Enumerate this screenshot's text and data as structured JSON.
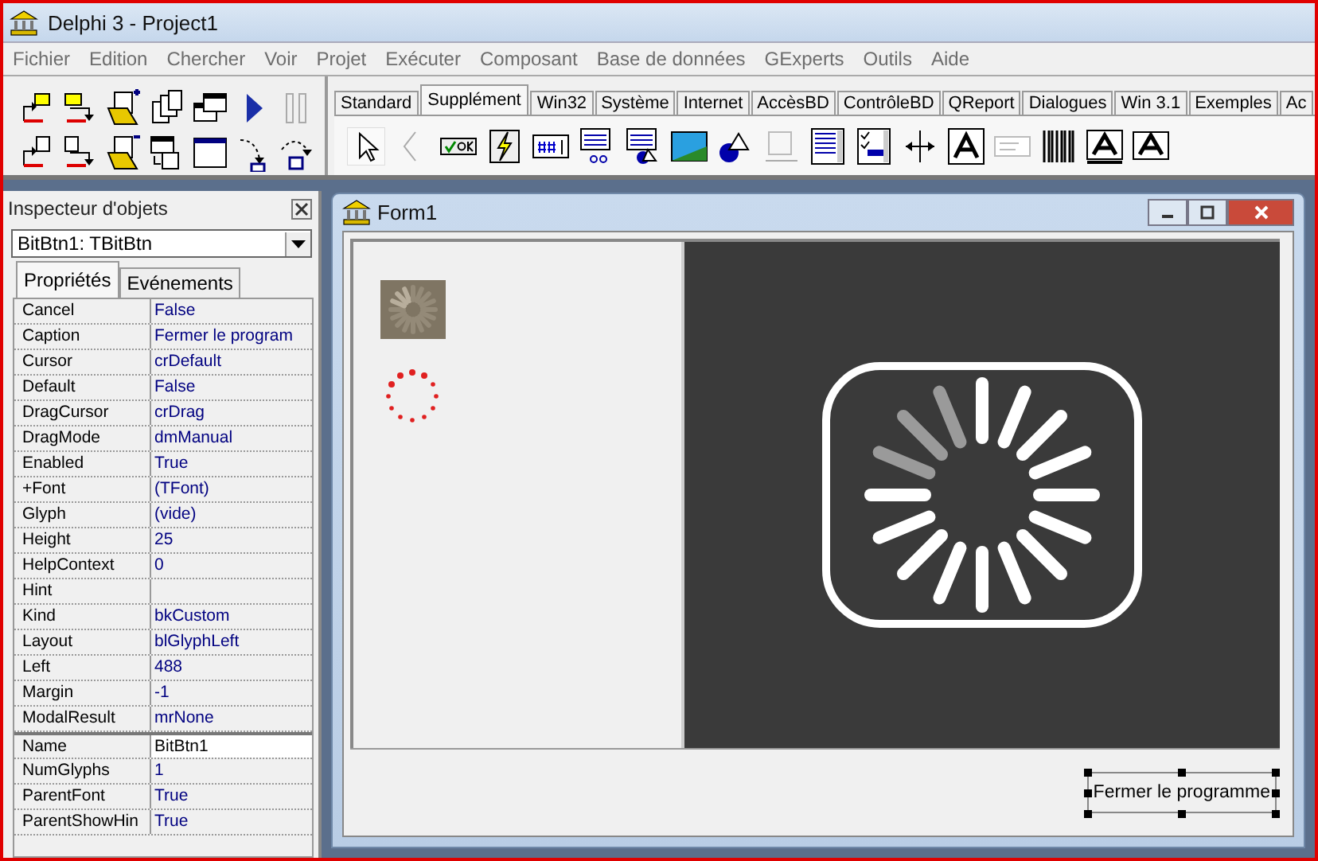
{
  "window": {
    "title": "Delphi 3 - Project1"
  },
  "menu": [
    "Fichier",
    "Edition",
    "Chercher",
    "Voir",
    "Projet",
    "Exécuter",
    "Composant",
    "Base de données",
    "GExperts",
    "Outils",
    "Aide"
  ],
  "palette_tabs": [
    {
      "label": "Standard",
      "selected": false
    },
    {
      "label": "Supplément",
      "selected": true
    },
    {
      "label": "Win32",
      "selected": false
    },
    {
      "label": "Système",
      "selected": false
    },
    {
      "label": "Internet",
      "selected": false
    },
    {
      "label": "AccèsBD",
      "selected": false
    },
    {
      "label": "ContrôleBD",
      "selected": false
    },
    {
      "label": "QReport",
      "selected": false
    },
    {
      "label": "Dialogues",
      "selected": false
    },
    {
      "label": "Win 3.1",
      "selected": false
    },
    {
      "label": "Exemples",
      "selected": false
    },
    {
      "label": "Ac",
      "selected": false
    }
  ],
  "inspector": {
    "title": "Inspecteur d'objets",
    "object": "BitBtn1: TBitBtn",
    "tabs": [
      {
        "label": "Propriétés",
        "selected": true
      },
      {
        "label": "Evénements",
        "selected": false
      }
    ],
    "properties": [
      {
        "name": "Cancel",
        "value": "False",
        "selected": false
      },
      {
        "name": "Caption",
        "value": "Fermer le program",
        "selected": false
      },
      {
        "name": "Cursor",
        "value": "crDefault",
        "selected": false
      },
      {
        "name": "Default",
        "value": "False",
        "selected": false
      },
      {
        "name": "DragCursor",
        "value": "crDrag",
        "selected": false
      },
      {
        "name": "DragMode",
        "value": "dmManual",
        "selected": false
      },
      {
        "name": "Enabled",
        "value": "True",
        "selected": false
      },
      {
        "name": "+Font",
        "value": "(TFont)",
        "selected": false
      },
      {
        "name": "Glyph",
        "value": "(vide)",
        "selected": false
      },
      {
        "name": "Height",
        "value": "25",
        "selected": false
      },
      {
        "name": "HelpContext",
        "value": "0",
        "selected": false
      },
      {
        "name": "Hint",
        "selected": false
      },
      {
        "name": "Kind",
        "value": "bkCustom",
        "selected": false
      },
      {
        "name": "Layout",
        "value": "blGlyphLeft",
        "selected": false
      },
      {
        "name": "Left",
        "value": "488",
        "selected": false
      },
      {
        "name": "Margin",
        "value": "-1",
        "selected": false
      },
      {
        "name": "ModalResult",
        "value": "mrNone",
        "selected": false
      },
      {
        "name": "Name",
        "value": "BitBtn1",
        "selected": true
      },
      {
        "name": "NumGlyphs",
        "value": "1",
        "selected": false
      },
      {
        "name": "ParentFont",
        "value": "True",
        "selected": false
      },
      {
        "name": "ParentShowHin",
        "value": "True",
        "selected": false
      }
    ]
  },
  "form": {
    "title": "Form1",
    "button": "Fermer le programme"
  }
}
